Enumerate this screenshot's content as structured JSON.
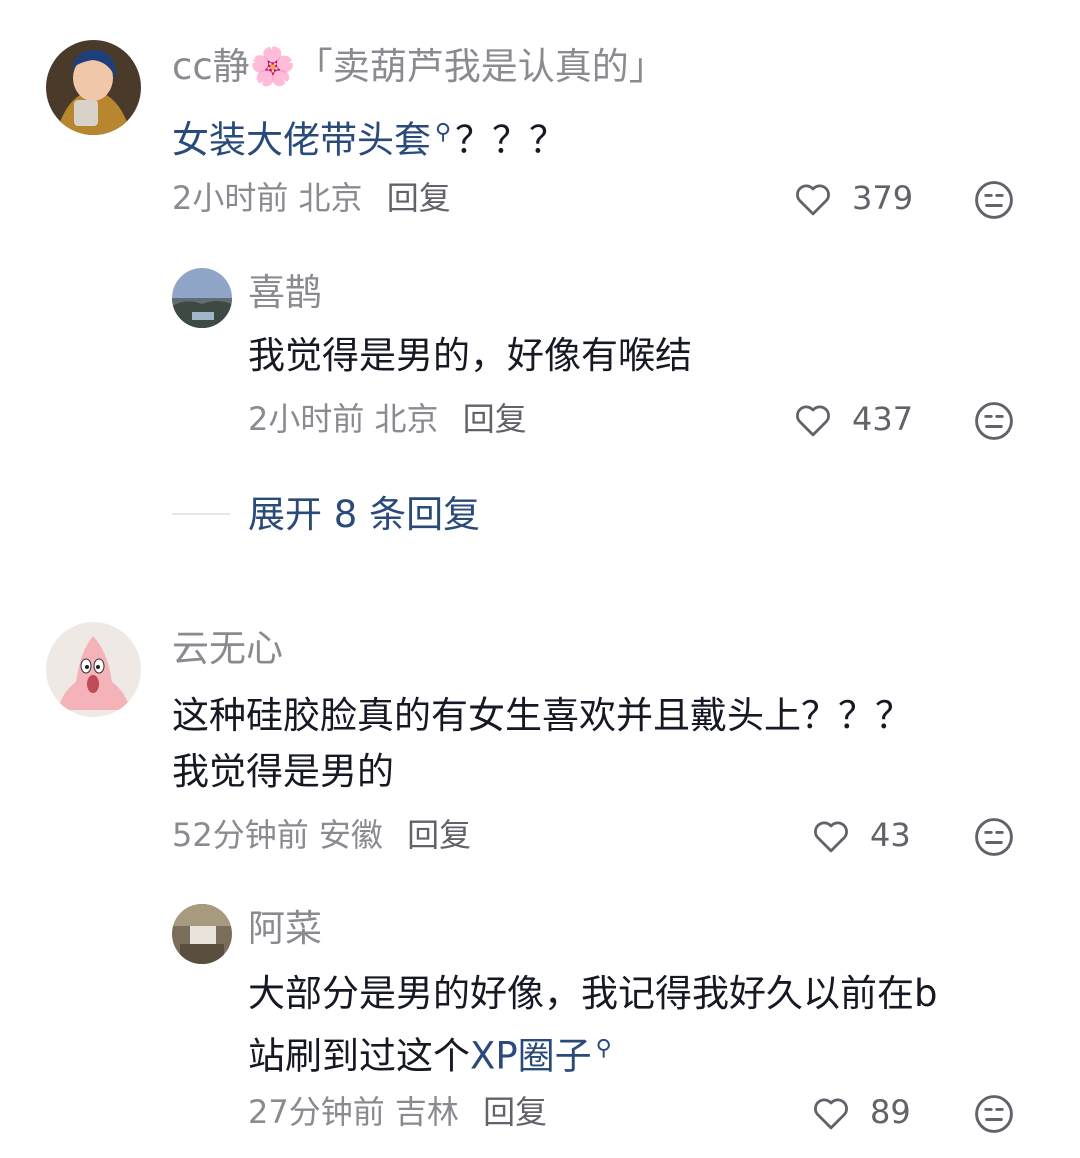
{
  "comments": [
    {
      "username": "cc静🌸「卖葫芦我是认真的」",
      "text_link": "女装大佬带头套",
      "text_rest": "？？？",
      "time": "2小时前",
      "location": "北京",
      "reply_label": "回复",
      "likes": "379",
      "replies": [
        {
          "username": "喜鹊",
          "text": "我觉得是男的，好像有喉结",
          "time": "2小时前",
          "location": "北京",
          "reply_label": "回复",
          "likes": "437"
        }
      ],
      "expand_label": "展开 8 条回复"
    },
    {
      "username": "云无心",
      "text_line1": "这种硅胶脸真的有女生喜欢并且戴头上？？？",
      "text_line2": "我觉得是男的",
      "time": "52分钟前",
      "location": "安徽",
      "reply_label": "回复",
      "likes": "43",
      "replies": [
        {
          "username": "阿菜",
          "text_line1": "大部分是男的好像，我记得我好久以前在b",
          "text_line2_plain": "站刷到过这个",
          "text_line2_link": "XP圈子",
          "time": "27分钟前",
          "location": "吉林",
          "reply_label": "回复",
          "likes": "89"
        }
      ]
    }
  ],
  "icons": {
    "like": "heart-outline-icon",
    "dislike": "meh-face-icon",
    "search": "search-icon"
  },
  "colors": {
    "text": "#161823",
    "muted": "#8a8b91",
    "link": "#2a4a7a",
    "background": "#ffffff"
  }
}
